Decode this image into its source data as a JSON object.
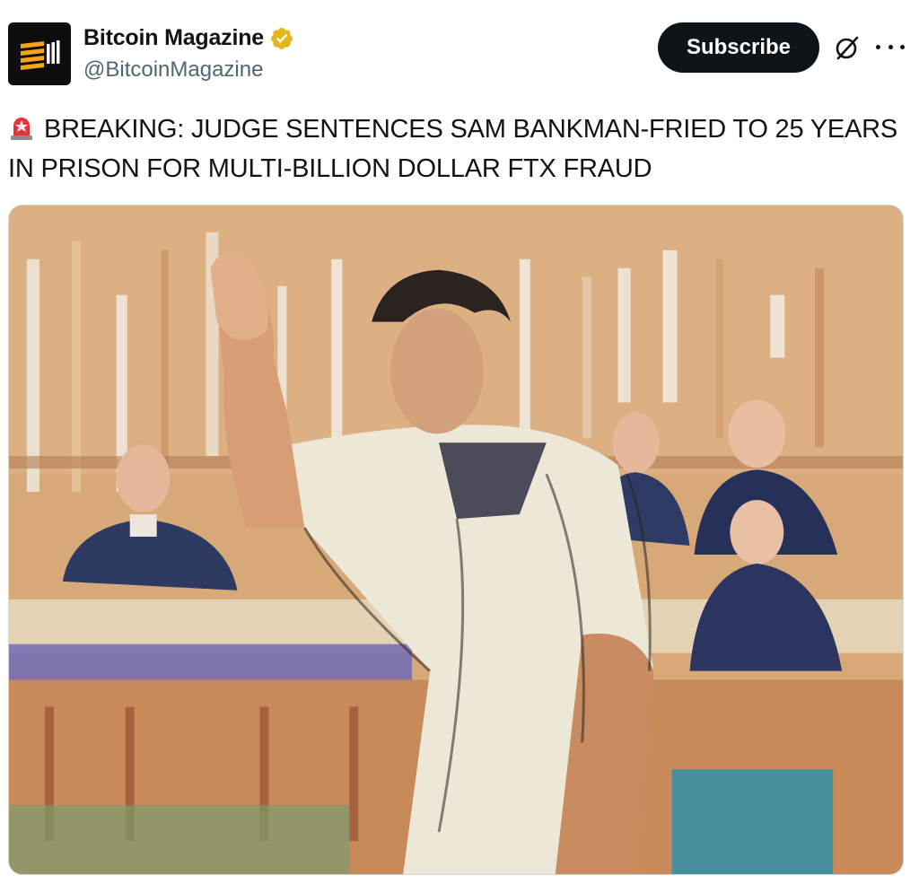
{
  "account": {
    "name": "Bitcoin Magazine",
    "handle": "@BitcoinMagazine",
    "verified_badge": "gold-verified-badge-icon",
    "avatar_icon": "bitcoin-magazine-logo"
  },
  "actions": {
    "subscribe_label": "Subscribe",
    "grok_icon": "grok-icon",
    "more_icon": "more-options-icon"
  },
  "tweet": {
    "emoji": "rotating-light-icon",
    "text": "BREAKING: JUDGE SENTENCES SAM BANKMAN-FRIED TO 25 YEARS IN PRISON FOR MULTI-BILLION DOLLAR FTX FRAUD"
  },
  "media": {
    "type": "courtroom-sketch-illustration"
  },
  "colors": {
    "subscribe_bg": "#0f1419",
    "handle": "#536471",
    "verified_gold": "#e2b719",
    "sketch_bg": "#d9ad7c"
  }
}
